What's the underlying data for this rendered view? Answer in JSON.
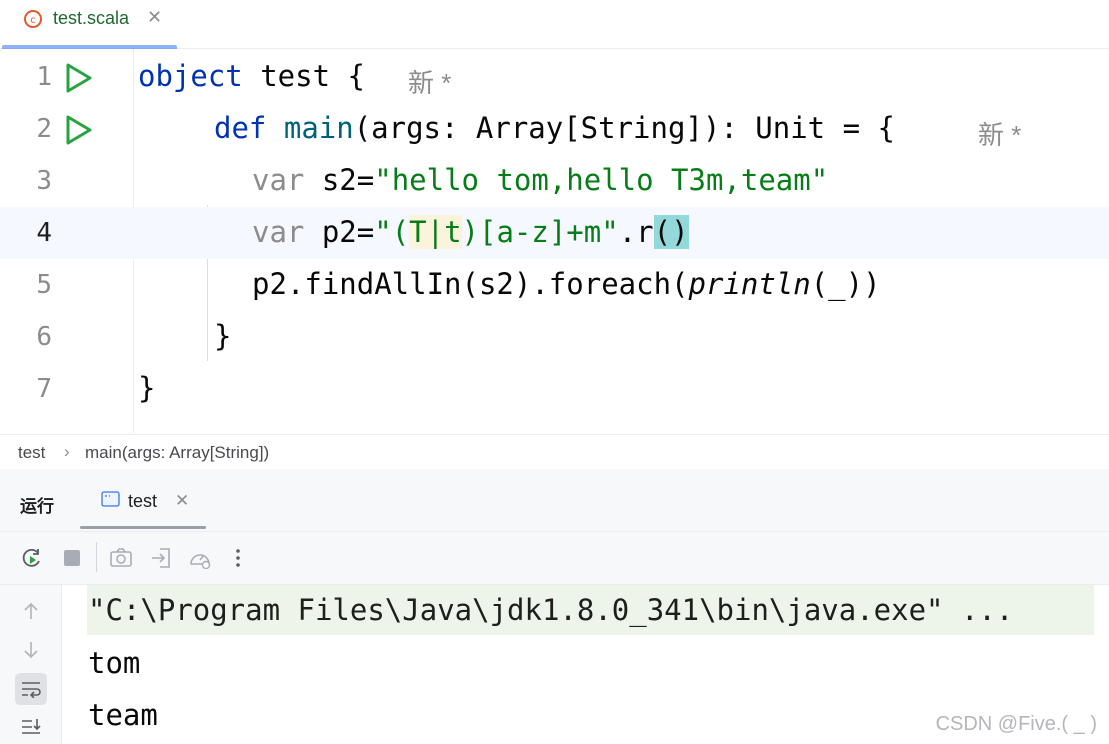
{
  "editor_tab": {
    "filename": "test.scala",
    "close_glyph": "✕",
    "icon": "scala-file-icon"
  },
  "code_lines": [
    {
      "n": "1"
    },
    {
      "n": "2"
    },
    {
      "n": "3"
    },
    {
      "n": "4"
    },
    {
      "n": "5"
    },
    {
      "n": "6"
    },
    {
      "n": "7"
    }
  ],
  "code": {
    "l1_kw": "object",
    "l1_name": " test {",
    "l1_hint": "新 *",
    "l2_kw": "def",
    "l2_fn": "main",
    "l2_rest": "(args: Array[String]): Unit = {",
    "l2_hint": "新 *",
    "l3_kw": "var",
    "l3_name": " s2=",
    "l3_str": "\"hello tom,hello T3m,team\"",
    "l4_kw": "var",
    "l4_name": " p2=",
    "l4_q1": "\"(",
    "l4_a": "T|t",
    "l4_b": ")[a-z]+m\"",
    "l4_c": ".r",
    "l4_d": "()",
    "l5_a": "p2.findAllIn(s2).foreach(",
    "l5_b": "println",
    "l5_c": "(_))",
    "l6": "}",
    "l7": "}"
  },
  "breadcrumb": {
    "item1": "test",
    "sep": "›",
    "item2": "main(args: Array[String])"
  },
  "run_panel": {
    "title": "运行",
    "tab_label": "test",
    "tab_close": "✕",
    "console_lines": [
      "\"C:\\Program Files\\Java\\jdk1.8.0_341\\bin\\java.exe\" ...",
      "tom",
      "team"
    ]
  },
  "watermark": "CSDN @Five.(    _  )",
  "colors": {
    "keyword": "#0033b3",
    "string": "#067d17",
    "run_green": "#29a341",
    "accent": "#3574f0"
  }
}
